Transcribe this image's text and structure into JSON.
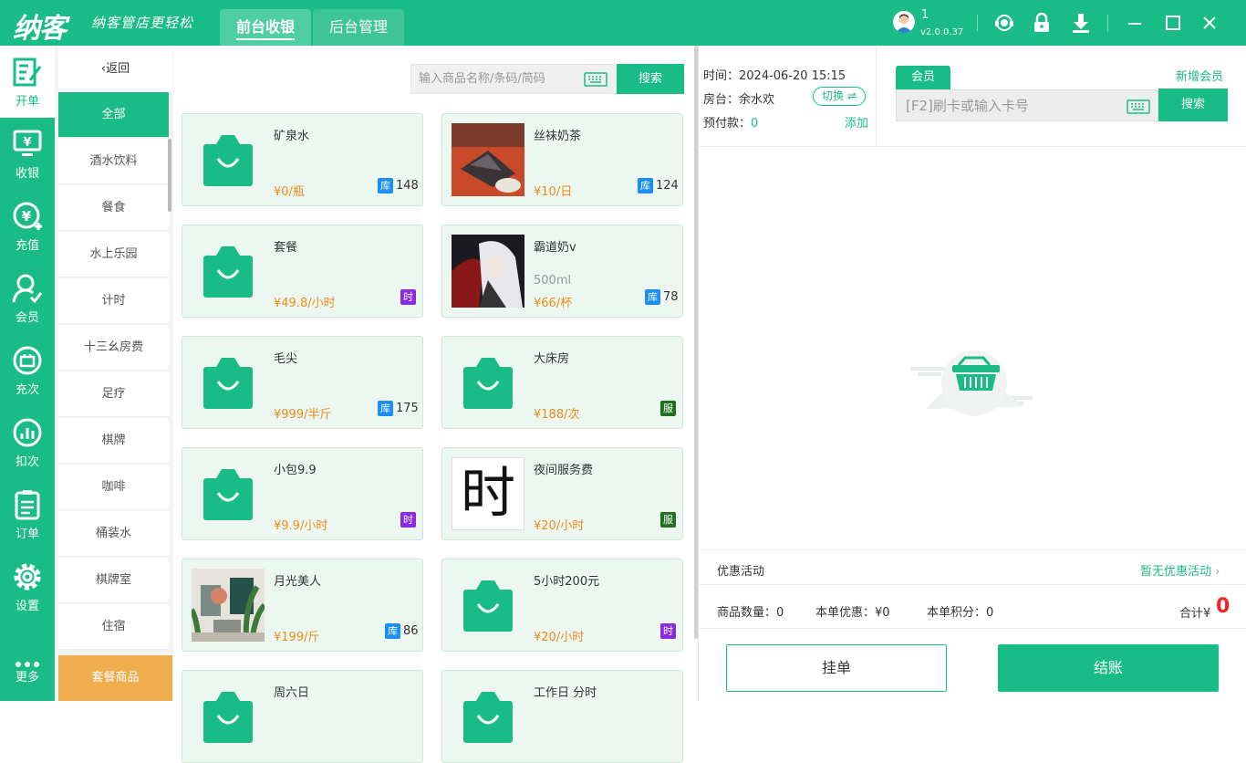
{
  "app": {
    "logo": "纳客",
    "slogan": "纳客管店更轻松",
    "tabs": [
      {
        "label": "前台收银"
      },
      {
        "label": "后台管理"
      }
    ],
    "user": {
      "name": "1",
      "version": "v2.0.0.37"
    }
  },
  "nav": [
    {
      "label": "开单",
      "icon": "edit-icon"
    },
    {
      "label": "收银",
      "icon": "cashier-icon"
    },
    {
      "label": "充值",
      "icon": "recharge-icon"
    },
    {
      "label": "会员",
      "icon": "member-icon"
    },
    {
      "label": "充次",
      "icon": "recharge-times-icon"
    },
    {
      "label": "扣次",
      "icon": "deduct-times-icon"
    },
    {
      "label": "订单",
      "icon": "order-icon"
    },
    {
      "label": "设置",
      "icon": "gear-icon"
    },
    {
      "label": "更多",
      "icon": "more-icon"
    }
  ],
  "categories": {
    "back_label": "返回",
    "items": [
      "全部",
      "酒水饮料",
      "餐食",
      "水上乐园",
      "计时",
      "十三幺房费",
      "足疗",
      "棋牌",
      "咖啡",
      "桶装水",
      "棋牌室",
      "住宿"
    ],
    "package_label": "套餐商品"
  },
  "search": {
    "placeholder": "输入商品名称/条码/简码",
    "button": "搜索"
  },
  "products": [
    {
      "name": "矿泉水",
      "sub": "",
      "price": "¥0/瓶",
      "badge": "库",
      "stock": "148",
      "image": "bag-icon"
    },
    {
      "name": "丝袜奶茶",
      "sub": "",
      "price": "¥10/日",
      "badge": "库",
      "stock": "124",
      "image": "food-photo"
    },
    {
      "name": "套餐",
      "sub": "",
      "price": "¥49.8/小时",
      "badge": "时",
      "stock": "",
      "image": "bag-icon"
    },
    {
      "name": "霸道奶v",
      "sub": "500ml",
      "price": "¥66/杯",
      "badge": "库",
      "stock": "78",
      "image": "character-photo"
    },
    {
      "name": "毛尖",
      "sub": "",
      "price": "¥999/半斤",
      "badge": "库",
      "stock": "175",
      "image": "bag-icon"
    },
    {
      "name": "大床房",
      "sub": "",
      "price": "¥188/次",
      "badge": "服",
      "stock": "",
      "image": "bag-icon"
    },
    {
      "name": "小包9.9",
      "sub": "",
      "price": "¥9.9/小时",
      "badge": "时",
      "stock": "",
      "image": "bag-icon"
    },
    {
      "name": "夜间服务费",
      "sub": "",
      "price": "¥20/小时",
      "badge": "服",
      "stock": "",
      "image": "shi-character-image",
      "image_text": "时"
    },
    {
      "name": "月光美人",
      "sub": "",
      "price": "¥199/斤",
      "badge": "库",
      "stock": "86",
      "image": "room-photo"
    },
    {
      "name": "5小时200元",
      "sub": "",
      "price": "¥20/小时",
      "badge": "时",
      "stock": "",
      "image": "bag-icon"
    },
    {
      "name": "周六日",
      "sub": "",
      "price": "",
      "badge": "",
      "stock": "",
      "image": "bag-icon"
    },
    {
      "name": "工作日 分时",
      "sub": "",
      "price": "",
      "badge": "",
      "stock": "",
      "image": "bag-icon"
    }
  ],
  "order": {
    "time_label": "时间：",
    "time": "2024-06-20 15:15",
    "room_label": "房台：",
    "room": "余水欢",
    "switch": "切换",
    "prepay_label": "预付款：",
    "prepay": "0",
    "add": "添加"
  },
  "member": {
    "tab": "会员",
    "new": "新增会员",
    "placeholder": "[F2]刷卡或输入卡号",
    "search": "搜索"
  },
  "promo": {
    "label": "优惠活动",
    "value": "暂无优惠活动"
  },
  "summary": {
    "qty_label": "商品数量：",
    "qty": "0",
    "discount_label": "本单优惠：",
    "discount": "¥0",
    "points_label": "本单积分：",
    "points": "0",
    "total_label": "合计¥",
    "total": "0"
  },
  "actions": {
    "hold": "挂单",
    "checkout": "结账"
  },
  "colors": {
    "primary": "#19bb87",
    "price": "#f08c1a",
    "stock_badge": "#1b8ff5",
    "time_badge": "#8a2be2",
    "service_badge": "#1f6f1f",
    "total": "#f52222",
    "package": "#f0ad4e"
  }
}
